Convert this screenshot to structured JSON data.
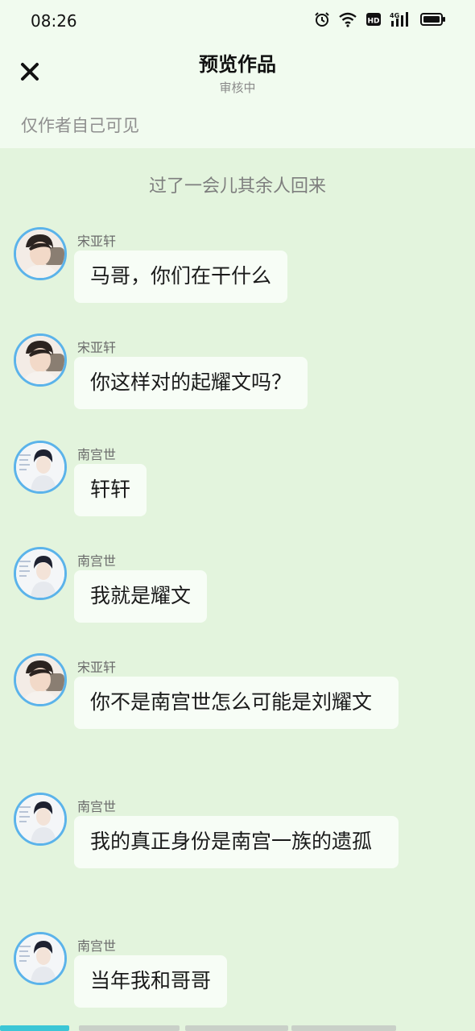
{
  "status_bar": {
    "time": "08:26",
    "icons": [
      "alarm-icon",
      "wifi-icon",
      "hd-icon",
      "cellular-4g-icon",
      "battery-icon"
    ],
    "hd_label": "HD",
    "network_label": "4G"
  },
  "header": {
    "title": "预览作品",
    "subtitle": "审核中",
    "close_icon": "close-icon"
  },
  "visibility_note": "仅作者自己可见",
  "narration": "过了一会儿其余人回来",
  "messages": [
    {
      "sender": "宋亚轩",
      "text": "马哥，你们在干什么",
      "avatar": "avatar-song"
    },
    {
      "sender": "宋亚轩",
      "text": "你这样对的起耀文吗？",
      "avatar": "avatar-song"
    },
    {
      "sender": "南宫世",
      "text": "轩轩",
      "avatar": "avatar-nangong"
    },
    {
      "sender": "南宫世",
      "text": "我就是耀文",
      "avatar": "avatar-nangong"
    },
    {
      "sender": "宋亚轩",
      "text": "你不是南宫世怎么可能是刘耀文",
      "avatar": "avatar-song"
    },
    {
      "sender": "南宫世",
      "text": "我的真正身份是南宫一族的遗孤",
      "avatar": "avatar-nangong"
    },
    {
      "sender": "南宫世",
      "text": "当年我和哥哥",
      "avatar": "avatar-nangong"
    }
  ],
  "colors": {
    "background": "#e3f4dd",
    "header_bg": "#f1fbef",
    "bubble_bg": "#f7fdf6",
    "avatar_border": "#5bb3ea",
    "progress_active": "#3cc6d6",
    "progress_inactive": "#c9d0c8"
  }
}
